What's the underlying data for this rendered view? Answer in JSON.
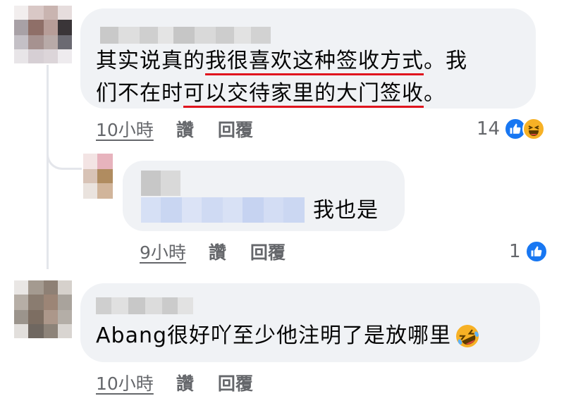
{
  "comments": [
    {
      "text_line1_a": "其实说真的",
      "text_line1_b": "我很喜欢这种签收方式",
      "text_line1_c": "。我",
      "text_line2_a": "们不在时",
      "text_line2_b": "可以交待家里的大门签收",
      "text_line2_c": "。",
      "time": "10小時",
      "like_label": "讚",
      "reply_label": "回覆",
      "reaction_count": "14",
      "reactions": [
        "like-icon",
        "haha-icon"
      ]
    },
    {
      "text": "我也是",
      "time": "9小時",
      "like_label": "讚",
      "reply_label": "回覆",
      "reaction_count": "1",
      "reactions": [
        "like-icon"
      ]
    },
    {
      "text": "Abang很好吖至少他注明了是放哪里",
      "emoji": "rolling-on-floor-laughing-icon",
      "time": "10小時",
      "like_label": "讚",
      "reply_label": "回覆"
    }
  ],
  "colors": {
    "bubble": "#f0f2f5",
    "underline": "#e0141e",
    "like_blue": "#1877f2",
    "meta_gray": "#65676b"
  }
}
